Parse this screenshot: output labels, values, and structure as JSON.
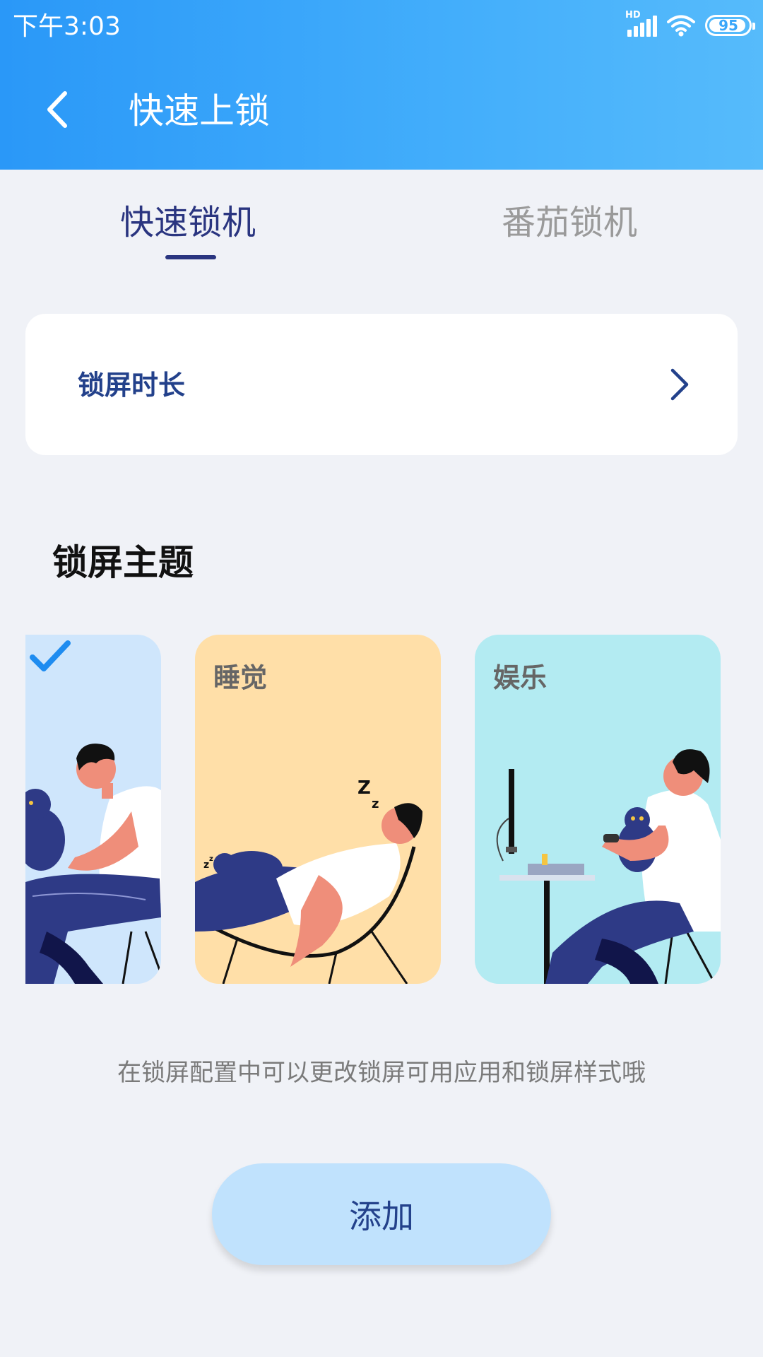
{
  "status_bar": {
    "time": "下午3:03",
    "signal_label": "HD",
    "battery_level": "95",
    "icons": [
      "signal-icon",
      "wifi-icon",
      "battery-icon"
    ]
  },
  "app_bar": {
    "title": "快速上锁",
    "back_icon": "chevron-left-icon"
  },
  "tabs": [
    {
      "label": "快速锁机",
      "active": true
    },
    {
      "label": "番茄锁机",
      "active": false
    }
  ],
  "duration_setting": {
    "label": "锁屏时长",
    "icon": "chevron-right-icon"
  },
  "theme_section": {
    "title": "锁屏主题",
    "themes": [
      {
        "label": "",
        "selected": true,
        "illustration": "person-with-cat-illustration"
      },
      {
        "label": "睡觉",
        "selected": false,
        "illustration": "person-sleeping-illustration"
      },
      {
        "label": "娱乐",
        "selected": false,
        "illustration": "person-gaming-illustration"
      }
    ]
  },
  "hint": "在锁屏配置中可以更改锁屏可用应用和锁屏样式哦",
  "add_button": "添加",
  "colors": {
    "header_start": "#2a98f8",
    "header_end": "#56bbfb",
    "tab_active": "#2a3580",
    "tab_inactive": "#9a9a9a",
    "accent_text": "#23418b",
    "button_bg": "#c0e2fd",
    "card_study": "#cfe6fc",
    "card_sleep": "#ffdfa8",
    "card_fun": "#b3ebf2",
    "check": "#1e8cf0"
  }
}
